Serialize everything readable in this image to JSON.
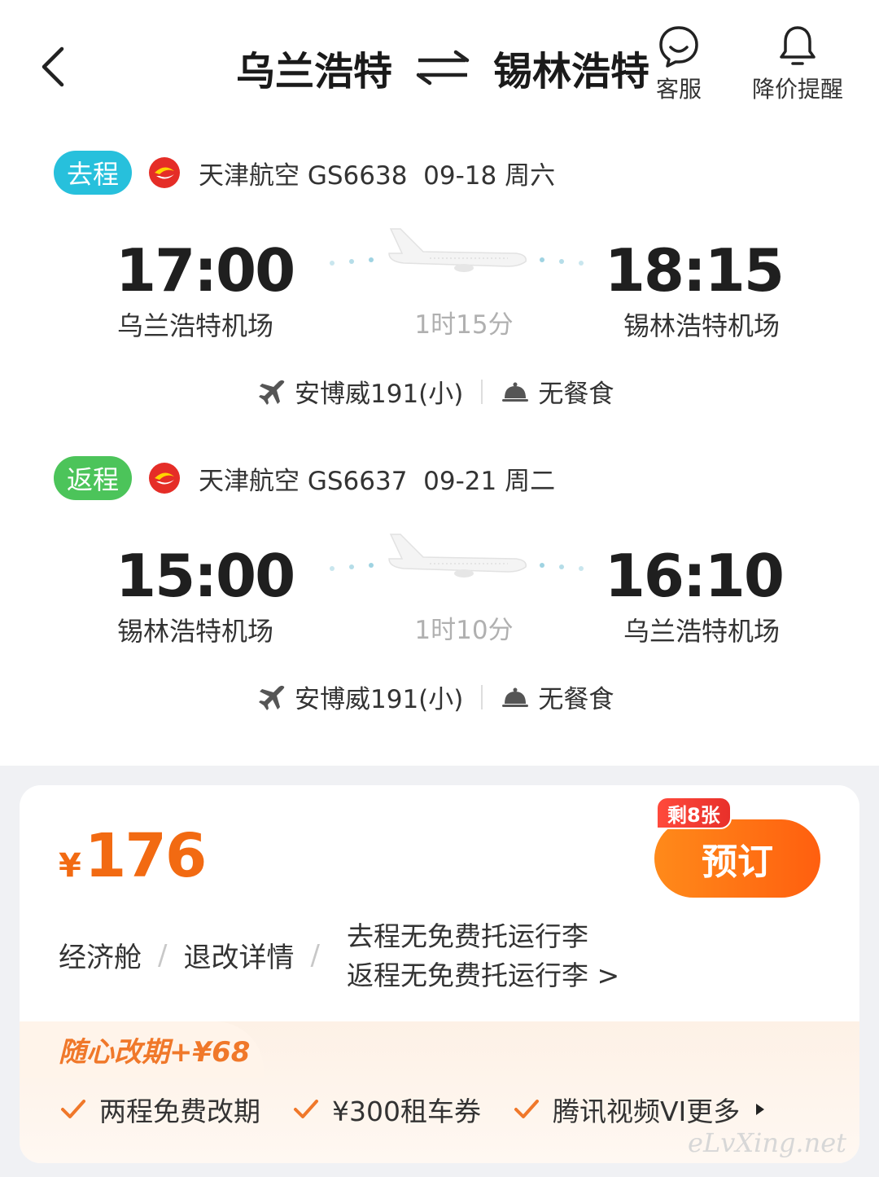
{
  "header": {
    "from_city": "乌兰浩特",
    "to_city": "锡林浩特",
    "kefu_label": "客服",
    "remind_label": "降价提醒"
  },
  "outbound": {
    "tag": "去程",
    "info": "天津航空 GS6638  09-18 周六",
    "dep_time": "17:00",
    "arr_time": "18:15",
    "dep_airport": "乌兰浩特机场",
    "arr_airport": "锡林浩特机场",
    "duration": "1时15分",
    "aircraft": "安博威191(小)",
    "meal": "无餐食"
  },
  "return": {
    "tag": "返程",
    "info": "天津航空 GS6637  09-21 周二",
    "dep_time": "15:00",
    "arr_time": "16:10",
    "dep_airport": "锡林浩特机场",
    "arr_airport": "乌兰浩特机场",
    "duration": "1时10分",
    "aircraft": "安博威191(小)",
    "meal": "无餐食"
  },
  "fare": {
    "currency": "¥",
    "price": "176",
    "stock_badge": "剩8张",
    "book_label": "预订",
    "cabin": "经济舱",
    "refund_label": "退改详情",
    "luggage_go": "去程无免费托运行李",
    "luggage_back": "返程无免费托运行李 >"
  },
  "perks": {
    "title": "随心改期+¥68",
    "items": [
      "两程免费改期",
      "¥300租车券",
      "腾讯视频VI"
    ],
    "more_label": "更多"
  },
  "watermark": "eLvXing.net",
  "colors": {
    "accent_orange": "#f26a12",
    "tag_go": "#27c0dc",
    "tag_back": "#4cc45a",
    "airline_red": "#e52d27"
  }
}
